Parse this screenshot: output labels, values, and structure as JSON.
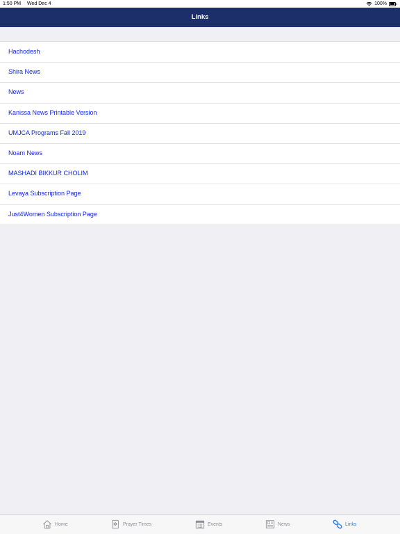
{
  "status_bar": {
    "time": "1:50 PM",
    "date": "Wed Dec 4",
    "battery": "100%"
  },
  "nav": {
    "title": "Links"
  },
  "links": [
    {
      "label": "Hachodesh"
    },
    {
      "label": "Shira News"
    },
    {
      "label": "News"
    },
    {
      "label": "Kanissa News Printable Version"
    },
    {
      "label": "UMJCA Programs Fall 2019"
    },
    {
      "label": "Noam News"
    },
    {
      "label": "MASHADI BIKKUR CHOLIM"
    },
    {
      "label": "Levaya Subscription Page"
    },
    {
      "label": "Just4Women Subscription Page"
    }
  ],
  "tab_bar": {
    "tabs": [
      {
        "label": "Home",
        "icon": "home-icon"
      },
      {
        "label": "Prayer Times",
        "icon": "prayer-book-icon"
      },
      {
        "label": "Events",
        "icon": "calendar-icon"
      },
      {
        "label": "News",
        "icon": "newspaper-icon"
      },
      {
        "label": "Links",
        "icon": "link-icon"
      }
    ],
    "active_tab": "Links"
  },
  "colors": {
    "nav_background": "#1c2f6b",
    "link_text": "#0a1fdc",
    "active_tab": "#2b7cf0",
    "inactive_tab": "#8e8e93",
    "page_background": "#efeff4"
  }
}
